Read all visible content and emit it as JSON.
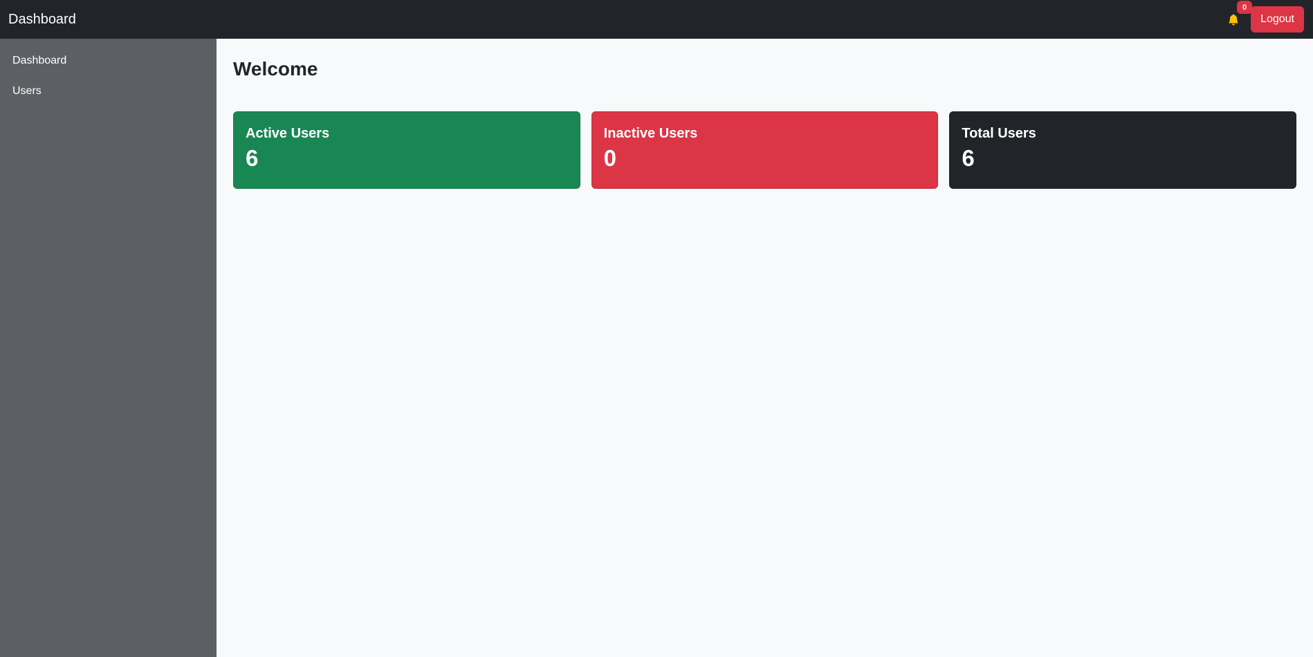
{
  "navbar": {
    "brand": "Dashboard",
    "notification_count": "0",
    "logout_label": "Logout"
  },
  "sidebar": {
    "items": [
      {
        "label": "Dashboard"
      },
      {
        "label": "Users"
      }
    ]
  },
  "main": {
    "title": "Welcome",
    "cards": [
      {
        "title": "Active Users",
        "value": "6",
        "color": "#198754"
      },
      {
        "title": "Inactive Users",
        "value": "0",
        "color": "#dc3545"
      },
      {
        "title": "Total Users",
        "value": "6",
        "color": "#212529"
      }
    ]
  },
  "icons": {
    "notifications": "bell-icon"
  },
  "colors": {
    "navbar_bg": "#212529",
    "sidebar_bg": "#5c6064",
    "main_bg": "#f8f9fa",
    "danger": "#dc3545",
    "bell": "#ffc107"
  }
}
